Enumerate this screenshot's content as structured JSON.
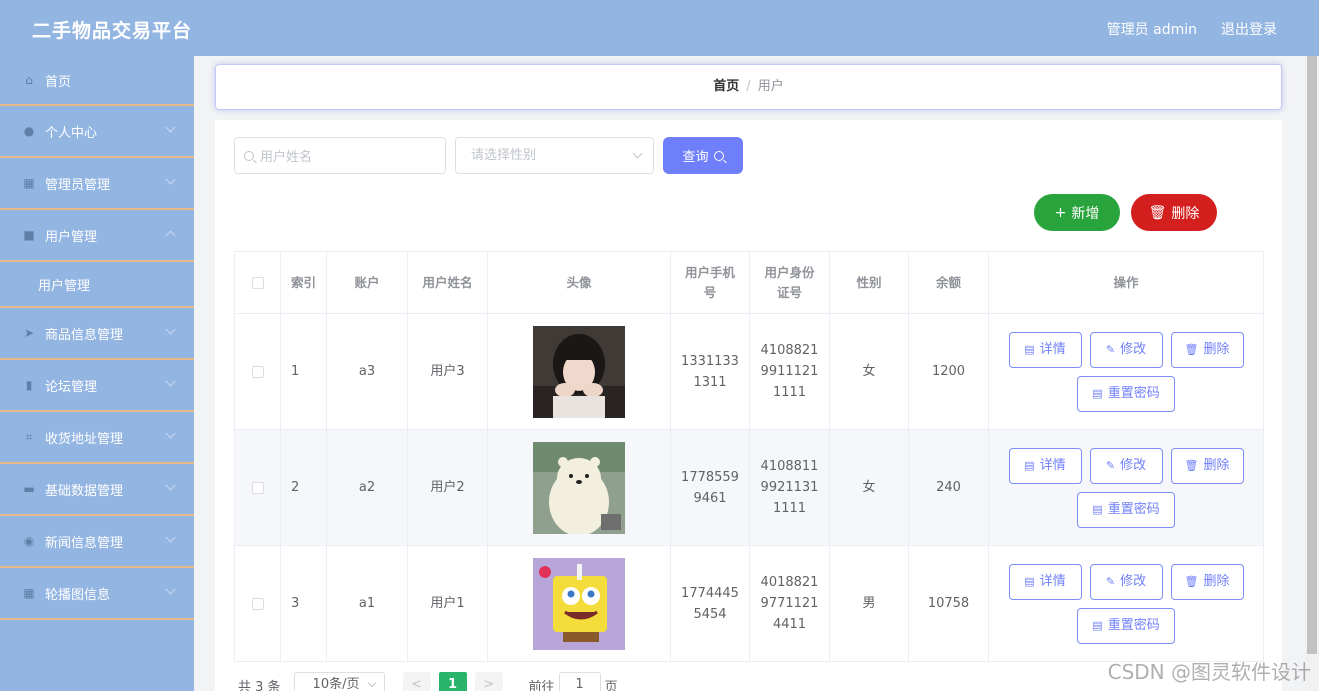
{
  "header": {
    "title": "二手物品交易平台",
    "user": "管理员 admin",
    "logout": "退出登录"
  },
  "sidebar": {
    "items": [
      {
        "label": "首页",
        "icon": "home-icon",
        "glyph": "⌂"
      },
      {
        "label": "个人中心",
        "icon": "person-icon",
        "glyph": "●"
      },
      {
        "label": "管理员管理",
        "icon": "grid-icon",
        "glyph": "▦"
      },
      {
        "label": "用户管理",
        "icon": "users-icon",
        "glyph": "■"
      },
      {
        "label": "用户管理",
        "icon": "",
        "glyph": ""
      },
      {
        "label": "商品信息管理",
        "icon": "send-icon",
        "glyph": "➤"
      },
      {
        "label": "论坛管理",
        "icon": "book-icon",
        "glyph": "▮"
      },
      {
        "label": "收货地址管理",
        "icon": "crop-icon",
        "glyph": "⌗"
      },
      {
        "label": "基础数据管理",
        "icon": "monitor-icon",
        "glyph": "▬"
      },
      {
        "label": "新闻信息管理",
        "icon": "compass-icon",
        "glyph": "◉"
      },
      {
        "label": "轮播图信息",
        "icon": "apps-icon",
        "glyph": "▦"
      }
    ]
  },
  "breadcrumb": {
    "home": "首页",
    "separator": "/",
    "current": "用户"
  },
  "search": {
    "name_placeholder": "用户姓名",
    "gender_placeholder": "请选择性别",
    "query_label": "查询"
  },
  "actions": {
    "add_label": "新增",
    "delete_label": "删除"
  },
  "table": {
    "headers": [
      "索引",
      "账户",
      "用户姓名",
      "头像",
      "用户手机号",
      "用户身份证号",
      "性别",
      "余额",
      "操作"
    ],
    "rows": [
      {
        "index": "1",
        "account": "a3",
        "name": "用户3",
        "phone": "13311331311",
        "idcard": "410882199111211111",
        "gender": "女",
        "balance": "1200"
      },
      {
        "index": "2",
        "account": "a2",
        "name": "用户2",
        "phone": "17785599461",
        "idcard": "410881199211311111",
        "gender": "女",
        "balance": "240"
      },
      {
        "index": "3",
        "account": "a1",
        "name": "用户1",
        "phone": "17744455454",
        "idcard": "401882197711214411",
        "gender": "男",
        "balance": "10758"
      }
    ],
    "ops": {
      "detail": "详情",
      "edit": "修改",
      "delete": "删除",
      "reset": "重置密码"
    }
  },
  "pagination": {
    "total": "共 3 条",
    "page_size": "10条/页",
    "prev": "<",
    "next": ">",
    "current_page": "1",
    "goto_prefix": "前往",
    "goto_value": "1",
    "goto_suffix": "页"
  },
  "watermark": "CSDN @图灵软件设计",
  "colors": {
    "header": "#93b5e2",
    "primary": "#6f7ff9",
    "success": "#29a33c",
    "danger": "#d41f1f",
    "menu_border": "#e9b889"
  }
}
